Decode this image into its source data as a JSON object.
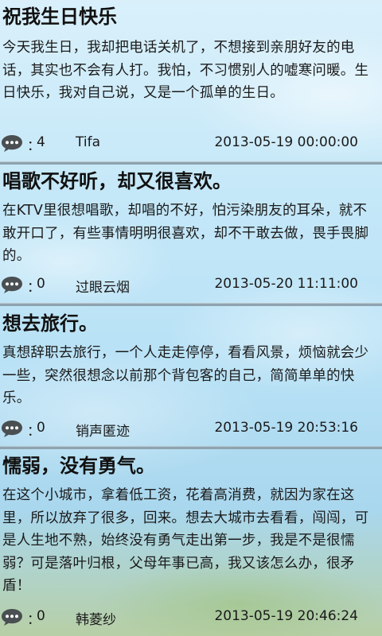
{
  "posts": [
    {
      "title": "祝我生日快乐",
      "body": "今天我生日，我却把电话关机了，不想接到亲朋好友的电话，其实也不会有人打。我怕，不习惯别人的嘘寒问暖。生日快乐，我对自己说，又是一个孤单的生日。",
      "colon": "：",
      "comments": "4",
      "author": "Tifa",
      "date": "2013-05-19 00:00:00"
    },
    {
      "title": "唱歌不好听，却又很喜欢。",
      "body": "在KTV里很想唱歌，却唱的不好，怕污染朋友的耳朵，就不敢开口了，有些事情明明很喜欢，却不干敢去做，畏手畏脚的。",
      "colon": "：",
      "comments": "0",
      "author": "过眼云烟",
      "date": "2013-05-20 11:11:00"
    },
    {
      "title": "想去旅行。",
      "body": "真想辞职去旅行，一个人走走停停，看看风景，烦恼就会少一些，突然很想念以前那个背包客的自己，简简单单的快乐。",
      "colon": "：",
      "comments": "0",
      "author": "销声匿迹",
      "date": "2013-05-19 20:53:16"
    },
    {
      "title": "懦弱，没有勇气。",
      "body": "在这个小城市，拿着低工资，花着高消费，就因为家在这里，所以放弃了很多，回来。想去大城市去看看，闯闯，可是人生地不熟，始终没有勇气走出第一步，我是不是很懦弱？可是落叶归根，父母年事已高，我又该怎么办，很矛盾！",
      "colon": "：",
      "comments": "0",
      "author": "韩菱纱",
      "date": "2013-05-19 20:46:24"
    }
  ],
  "icons": {
    "comment": "speech-bubble-icon"
  },
  "colors": {
    "divider": "#8ea3af",
    "text": "#1a1a1a",
    "icon": "#4a4f52"
  }
}
